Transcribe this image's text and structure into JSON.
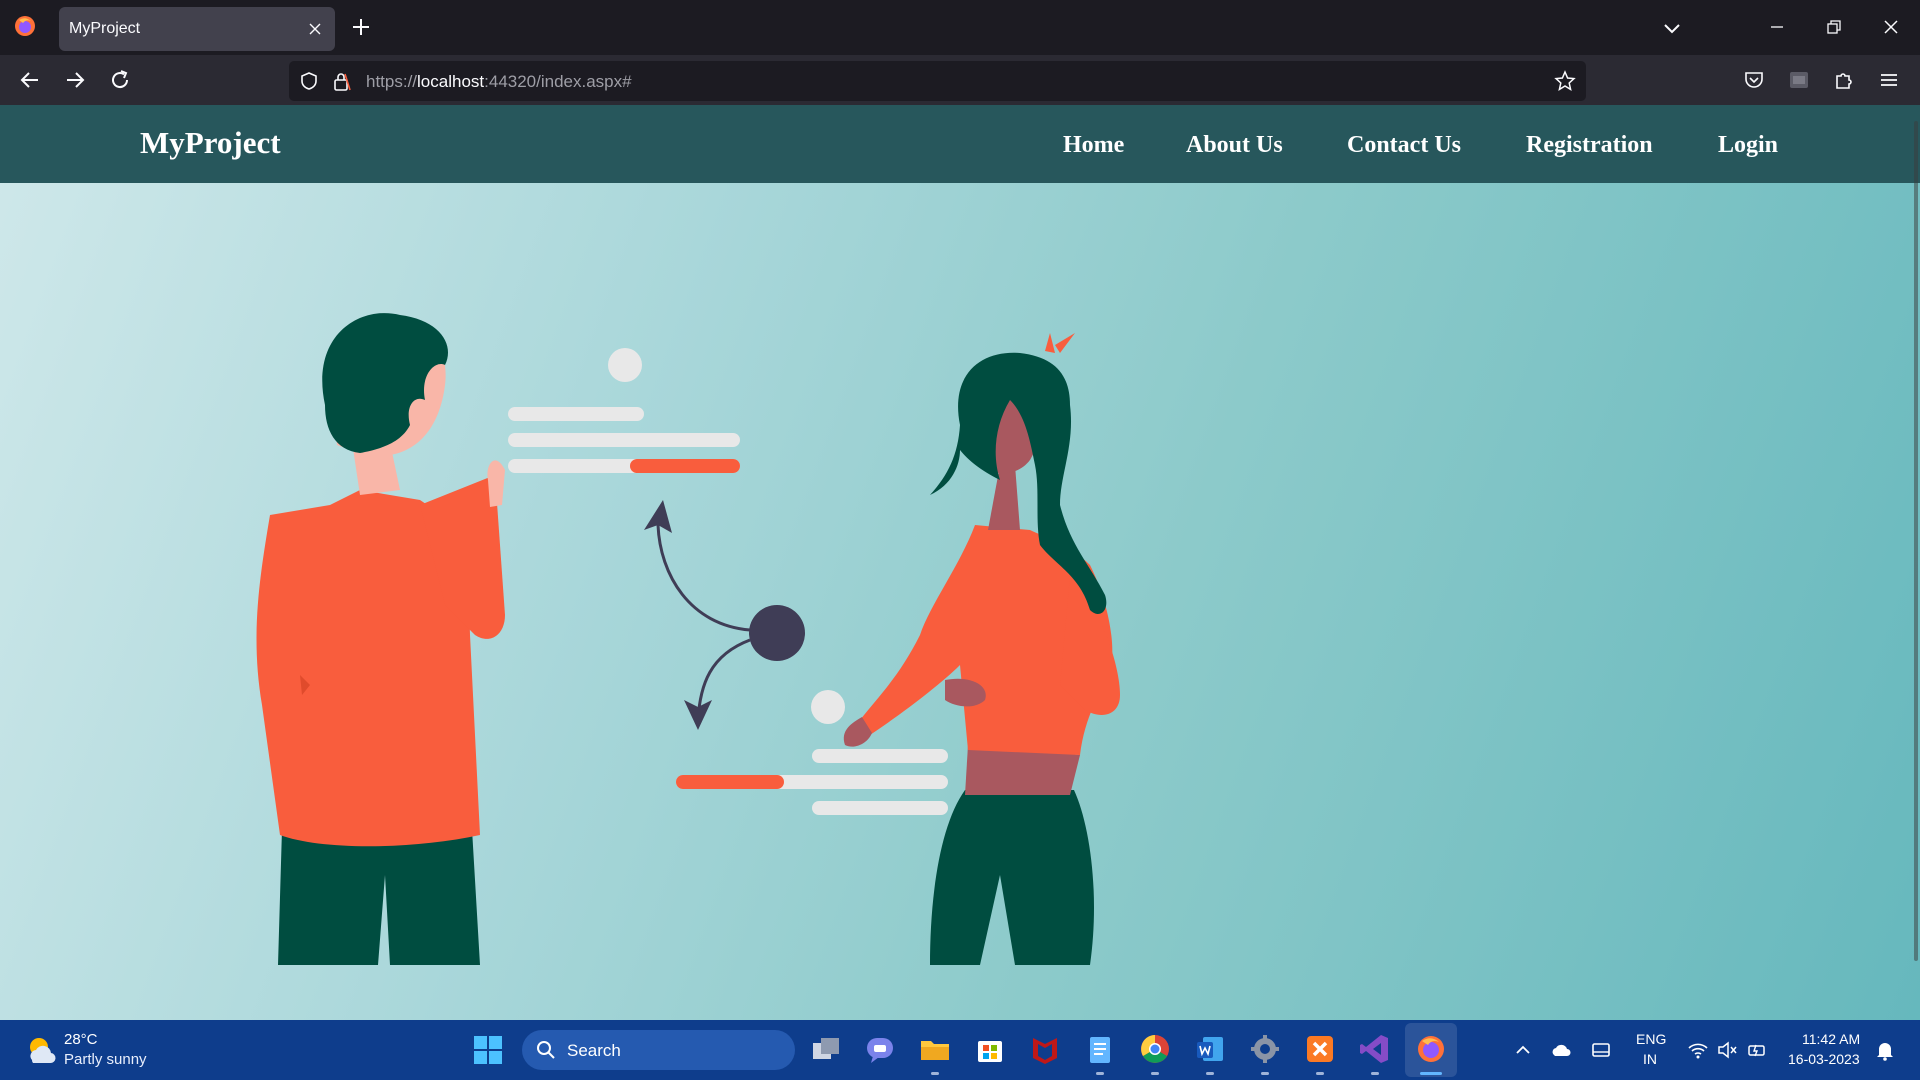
{
  "browser": {
    "tab_title": "MyProject",
    "url_prefix": "https://",
    "url_host": "localhost",
    "url_rest": ":44320/index.aspx#"
  },
  "site": {
    "brand": "MyProject",
    "menu": [
      "Home",
      "About Us",
      "Contact Us",
      "Registration",
      "Login"
    ],
    "colors": {
      "header": "#27575c",
      "accent": "#f95d3d",
      "dark_green": "#004d40"
    }
  },
  "taskbar": {
    "weather_temp": "28°C",
    "weather_desc": "Partly sunny",
    "search_label": "Search",
    "apps": [
      "task-view",
      "teams",
      "file-explorer",
      "microsoft-store",
      "mcafee",
      "notepad",
      "chrome",
      "word",
      "settings",
      "xampp",
      "visual-studio",
      "firefox"
    ],
    "lang_line1": "ENG",
    "lang_line2": "IN",
    "time": "11:42 AM",
    "date": "16-03-2023"
  }
}
